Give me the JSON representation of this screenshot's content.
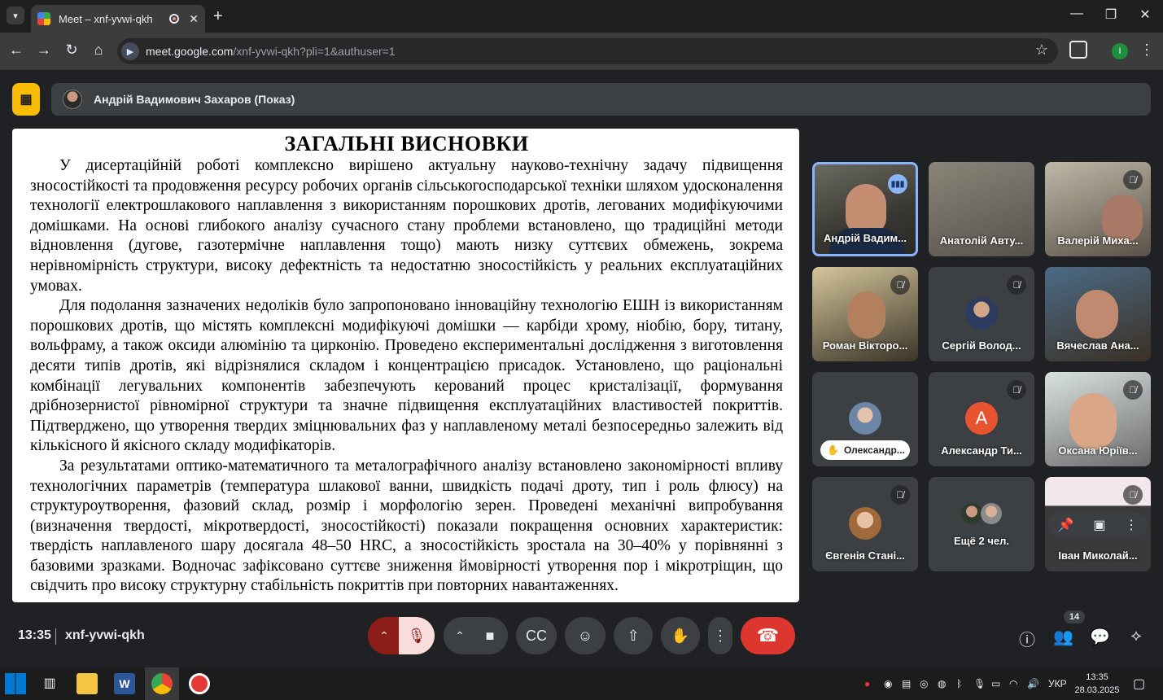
{
  "browser": {
    "tab_title": "Meet – xnf-yvwi-qkh",
    "url_host": "meet.google.com",
    "url_path": "/xnf-yvwi-qkh?pli=1&authuser=1",
    "profile_initial": "I"
  },
  "presenter": {
    "label": "Андрій Вадимович Захаров (Показ)"
  },
  "slide": {
    "title": "ЗАГАЛЬНІ ВИСНОВКИ",
    "paragraphs": [
      "У дисертаційній роботі комплексно вирішено актуальну науково-технічну задачу підвищення зносостійкості та продовження ресурсу робочих органів сільськогосподарської техніки шляхом удосконалення технології електрошлакового наплавлення з використанням порошкових дротів, легованих модифікуючими домішками. На основі глибокого аналізу сучасного стану проблеми встановлено, що традиційні методи відновлення (дугове, газотермічне наплавлення тощо) мають низку суттєвих обмежень, зокрема нерівномірність структури, високу дефектність та недостатню зносостійкість у реальних експлуатаційних умовах.",
      "Для подолання зазначених недоліків було запропоновано інноваційну технологію ЕШН із використанням порошкових дротів, що містять комплексні модифікуючі домішки — карбіди хрому, ніобію, бору, титану, вольфраму, а також оксиди алюмінію та цирконію. Проведено експериментальні дослідження з виготовлення десяти типів дротів, які відрізнялися складом і концентрацією присадок. Установлено, що раціональні комбінації легувальних компонентів забезпечують керований процес кристалізації, формування дрібнозернистої рівномірної структури та значне підвищення експлуатаційних властивостей покриттів. Підтверджено, що утворення твердих зміцнювальних фаз у наплавленому металі безпосередньо залежить від кількісного й якісного складу модифікаторів.",
      "За результатами оптико-математичного та металографічного аналізу встановлено закономірності впливу технологічних параметрів (температура шлакової ванни, швидкість подачі дроту, тип і роль флюсу) на структуроутворення, фазовий склад, розмір і морфологію зерен. Проведені механічні випробування (визначення твердості, мікротвердості, зносостійкості) показали покращення основних характеристик: твердість наплавленого шару досягала 48–50 HRC, а зносостійкість зростала на 30–40% у порівнянні з базовими зразками. Водночас зафіксовано суттєве зниження ймовірності утворення пор і мікротріщин, що свідчить про високу структурну стабільність покриттів при повторних навантаженнях."
    ]
  },
  "participants": [
    {
      "name": "Андрій Вадим...",
      "state": "speaking"
    },
    {
      "name": "Анатолій Авту...",
      "state": "video"
    },
    {
      "name": "Валерій Миха...",
      "state": "muted"
    },
    {
      "name": "Роман Вікторо...",
      "state": "muted"
    },
    {
      "name": "Сергій Волод...",
      "state": "muted"
    },
    {
      "name": "Вячеслав Ана...",
      "state": "video"
    },
    {
      "name": "Олександр...",
      "state": "hand-raised"
    },
    {
      "name": "Александр Ти...",
      "state": "muted",
      "initial": "А"
    },
    {
      "name": "Оксана Юріїв...",
      "state": "muted"
    },
    {
      "name": "Євгенія Стані...",
      "state": "muted"
    },
    {
      "name": "Ещё 2 чел.",
      "state": "group"
    },
    {
      "name": "Іван Миколай...",
      "state": "muted"
    }
  ],
  "meeting": {
    "time": "13:35",
    "code": "xnf-yvwi-qkh",
    "participant_count": "14"
  },
  "taskbar": {
    "lang": "УКР",
    "time": "13:35",
    "date": "28.03.2025"
  },
  "colors": {
    "accent_blue": "#8ab4f8",
    "leave_red": "#dc362e",
    "mic_off_bg": "#f9dedc",
    "present_yellow": "#fbbc04"
  }
}
